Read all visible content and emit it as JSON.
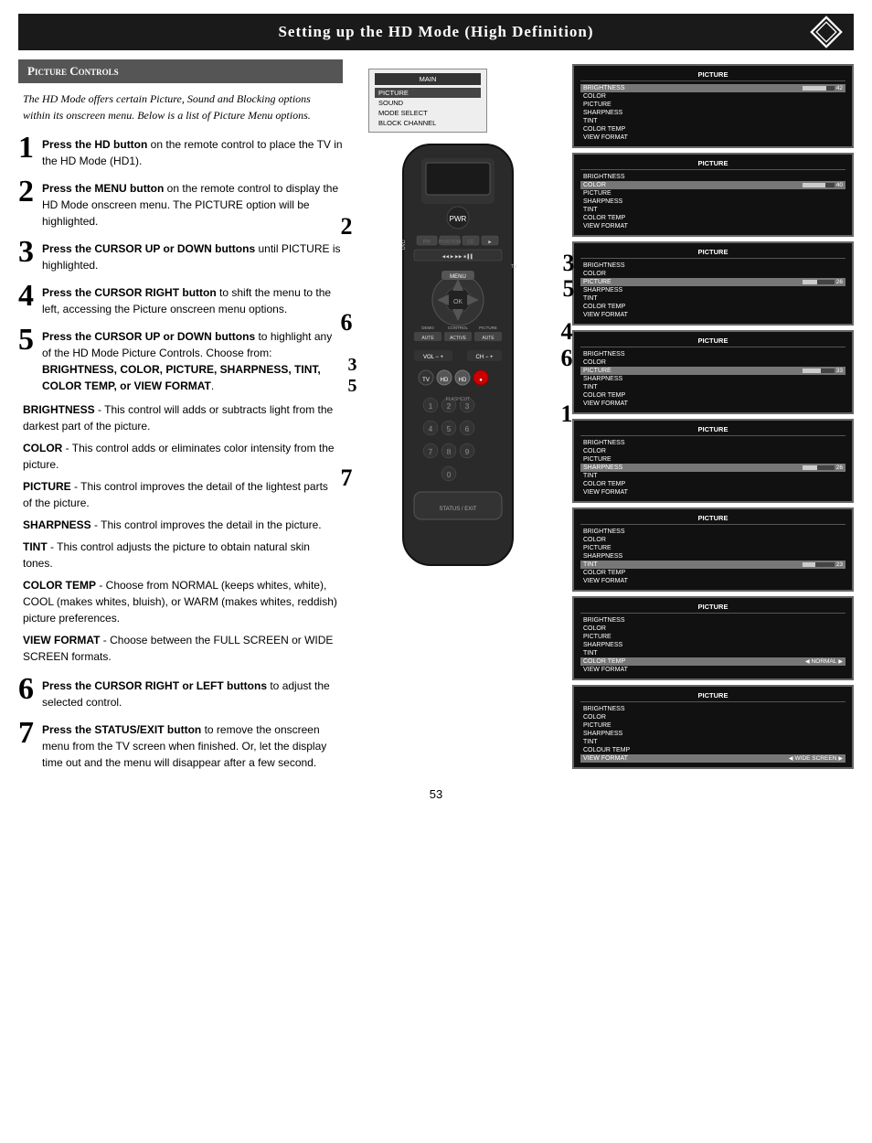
{
  "header": {
    "title": "Setting up the HD Mode (High Definition)"
  },
  "picture_controls": {
    "section_title": "Picture Controls",
    "intro": "The HD Mode offers certain Picture, Sound and Blocking options within its onscreen menu. Below is a list of Picture Menu options.",
    "steps": [
      {
        "num": "1",
        "text": "Press the HD button on the remote control to place the TV in the HD Mode (HD1)."
      },
      {
        "num": "2",
        "text": "Press the MENU button on the remote control to display the HD Mode onscreen menu. The PICTURE option will be highlighted."
      },
      {
        "num": "3",
        "text": "Press the CURSOR UP or DOWN buttons until PICTURE is highlighted."
      },
      {
        "num": "4",
        "text": "Press the CURSOR RIGHT button to shift the menu to the left, accessing the Picture onscreen menu options."
      },
      {
        "num": "5",
        "text": "Press the CURSOR UP or DOWN buttons to highlight any of the HD Mode Picture Controls. Choose from: BRIGHTNESS, COLOR, PICTURE, SHARPNESS, TINT, COLOR TEMP, or VIEW FORMAT."
      }
    ],
    "descriptions": [
      {
        "title": "BRIGHTNESS",
        "text": " - This control will adds or subtracts light from the darkest part of the picture."
      },
      {
        "title": "COLOR",
        "text": " - This control adds or eliminates color intensity from the picture."
      },
      {
        "title": "PICTURE",
        "text": " - This control improves the detail of the lightest parts of the picture."
      },
      {
        "title": "SHARPNESS",
        "text": " - This control improves the detail in the picture."
      },
      {
        "title": "TINT",
        "text": " - This control adjusts the picture to obtain natural skin tones."
      },
      {
        "title": "COLOR TEMP",
        "text": " - Choose from NORMAL (keeps whites, white), COOL (makes whites, bluish), or WARM (makes whites, reddish) picture preferences."
      },
      {
        "title": "VIEW FORMAT",
        "text": " - Choose between the FULL SCREEN or WIDE SCREEN formats."
      }
    ],
    "step6": {
      "num": "6",
      "text": "Press the CURSOR RIGHT or LEFT buttons to adjust the selected control."
    },
    "step7": {
      "num": "7",
      "text": "Press the STATUS/EXIT button to remove the onscreen menu from the TV screen when finished. Or, let the display time out and the menu will disappear after a few second."
    }
  },
  "tv_main_menu": {
    "header": "MAIN",
    "items": [
      "PICTURE",
      "SOUND",
      "MODE SELECT",
      "BLOCK CHANNEL"
    ],
    "selected": "PICTURE"
  },
  "screens": [
    {
      "title": "PICTURE",
      "items": [
        "BRIGHTNESS",
        "COLOR",
        "PICTURE",
        "SHARPNESS",
        "TINT",
        "COLOR TEMP",
        "VIEW FORMAT"
      ],
      "active": "BRIGHTNESS",
      "slider_val": "42"
    },
    {
      "title": "PICTURE",
      "items": [
        "BRIGHTNESS",
        "COLOR",
        "PICTURE",
        "SHARPNESS",
        "TINT",
        "COLOR TEMP",
        "VIEW FORMAT"
      ],
      "active": "COLOR",
      "slider_val": "40"
    },
    {
      "title": "PICTURE",
      "items": [
        "BRIGHTNESS",
        "COLOR",
        "PICTURE",
        "SHARPNESS",
        "TINT",
        "COLOR TEMP",
        "VIEW FORMAT"
      ],
      "active": "PICTURE",
      "slider_val": "26"
    },
    {
      "title": "PICTURE",
      "items": [
        "BRIGHTNESS",
        "COLOR",
        "PICTURE",
        "SHARPNESS",
        "TINT",
        "COLOR TEMP",
        "VIEW FORMAT"
      ],
      "active": "PICTURE",
      "slider_val": "33"
    },
    {
      "title": "PICTURE",
      "items": [
        "BRIGHTNESS",
        "COLOR",
        "PICTURE",
        "SHARPNESS",
        "TINT",
        "COLOR TEMP",
        "VIEW FORMAT"
      ],
      "active": "SHARPNESS",
      "slider_val": "26"
    },
    {
      "title": "PICTURE",
      "items": [
        "BRIGHTNESS",
        "COLOR",
        "PICTURE",
        "SHARPNESS",
        "TINT",
        "COLOR TEMP",
        "VIEW FORMAT"
      ],
      "active": "TINT",
      "slider_val": "23"
    },
    {
      "title": "PICTURE",
      "items": [
        "BRIGHTNESS",
        "COLOR",
        "PICTURE",
        "SHARPNESS",
        "TINT",
        "COLOR TEMP",
        "VIEW FORMAT"
      ],
      "active": "COLOR TEMP",
      "slider_text": "NORMAL"
    },
    {
      "title": "PICTURE",
      "items": [
        "BRIGHTNESS",
        "COLOR",
        "PICTURE",
        "SHARPNESS",
        "TINT",
        "COLOUR TEMP",
        "VIEW FORMAT"
      ],
      "active": "VIEW FORMAT",
      "slider_text": "WIDE SCREEN"
    }
  ],
  "page_number": "53"
}
